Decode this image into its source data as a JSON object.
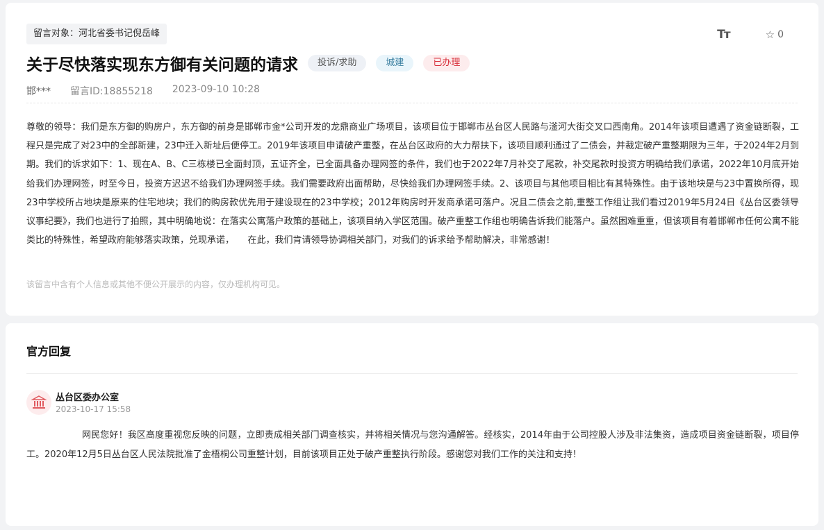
{
  "message": {
    "target": "留言对象：河北省委书记倪岳峰",
    "title": "关于尽快落实现东方御有关问题的请求",
    "tags": [
      "投诉/求助",
      "城建",
      "已办理"
    ],
    "author": "邯***",
    "message_id": "留言ID:18855218",
    "datetime": "2023-09-10 10:28",
    "favorite_count": "0",
    "font_size_icon_text": "Tт",
    "content": "尊敬的领导：我们是东方御的购房户，东方御的前身是邯郸市金*公司开发的龙鼎商业广场项目，该项目位于邯郸市丛台区人民路与滏河大街交叉口西南角。2014年该项目遭遇了资金链断裂，工程只是完成了对23中的全部新建，23中迁入新址后便停工。2019年该项目申请破产重整，在丛台区政府的大力帮扶下，该项目顺利通过了二债会，并裁定破产重整期限为三年，于2024年2月到期。我们的诉求如下：1、现在A、B、C三栋楼已全面封顶，五证齐全，已全面具备办理网签的条件，我们也于2022年7月补交了尾款，补交尾款时投资方明确给我们承诺，2022年10月底开始给我们办理网签，时至今日，投资方迟迟不给我们办理网签手续。我们需要政府出面帮助，尽快给我们办理网签手续。2、该项目与其他项目相比有其特殊性。由于该地块是与23中置换所得，现23中学校所占地块是原来的住宅地块；我们的购房款优先用于建设现在的23中学校；2012年购房时开发商承诺可落户。况且二债会之前,重整工作组让我们看过2019年5月24日《丛台区委领导议事纪要》，我们也进行了拍照，其中明确地说：在落实公寓落户政策的基础上，该项目纳入学区范围。破产重整工作组也明确告诉我们能落户。虽然困难重重，但该项目有着邯郸市任何公寓不能类比的特殊性，希望政府能够落实政策，兑现承诺，　　在此，我们肯请领导协调相关部门，对我们的诉求给予帮助解决，非常感谢！",
    "privacy_note": "该留言中含有个人信息或其他不便公开展示的内容，仅办理机构可见。"
  },
  "reply": {
    "header": "官方回复",
    "department": "丛台区委办公室",
    "datetime": "2023-10-17 15:58",
    "content": "网民您好！我区高度重视您反映的问题，立即责成相关部门调查核实，并将相关情况与您沟通解答。经核实，2014年由于公司控股人涉及非法集资，造成项目资金链断裂，项目停工。2020年12月5日丛台区人民法院批准了金梧桐公司重整计划，目前该项目正处于破产重整执行阶段。感谢您对我们工作的关注和支持！"
  },
  "icons": {
    "font_size": "font-size-icon",
    "favorite": "star-icon",
    "department": "government-building-icon"
  },
  "colors": {
    "status_red": "#d8303b",
    "category_blue": "#3a7fa0",
    "avatar_bg": "#fdeced"
  }
}
